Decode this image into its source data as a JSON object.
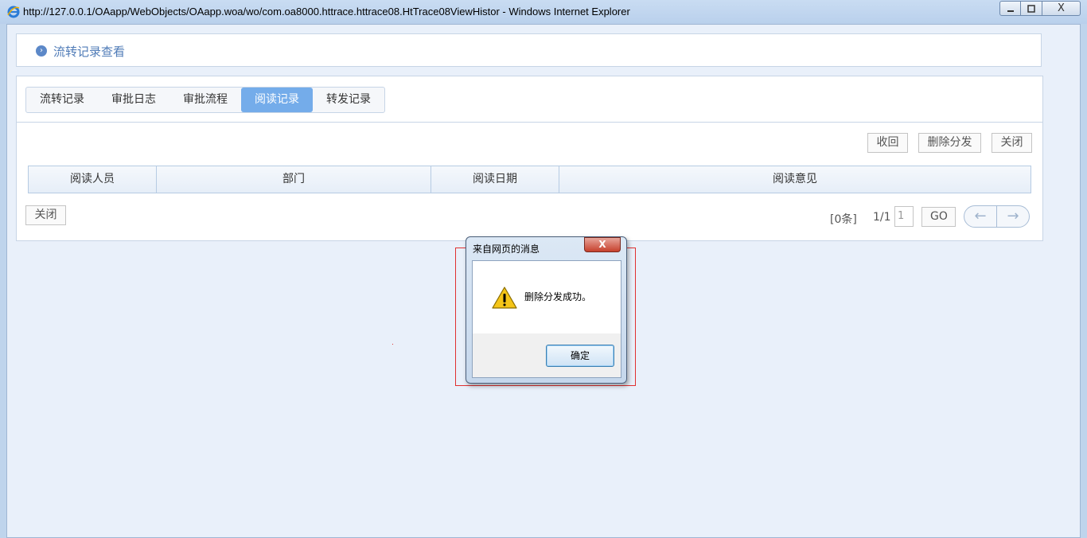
{
  "window": {
    "title": "http://127.0.0.1/OAapp/WebObjects/OAapp.woa/wo/com.oa8000.httrace.httrace08.HtTrace08ViewHistor - Windows Internet Explorer",
    "minimize_icon": "minimize-icon",
    "maximize_icon": "maximize-icon",
    "close_label": "X"
  },
  "header": {
    "title": "流转记录查看"
  },
  "tabs": [
    {
      "label": "流转记录",
      "active": false
    },
    {
      "label": "审批日志",
      "active": false
    },
    {
      "label": "审批流程",
      "active": false
    },
    {
      "label": "阅读记录",
      "active": true
    },
    {
      "label": "转发记录",
      "active": false
    }
  ],
  "toolbar": {
    "recall_label": "收回",
    "delete_distribution_label": "删除分发",
    "close_label": "关闭"
  },
  "table": {
    "columns": [
      "阅读人员",
      "部门",
      "阅读日期",
      "阅读意见"
    ],
    "rows": []
  },
  "footer": {
    "close_label": "关闭",
    "record_count": "[0条]",
    "page_indicator": "1/1",
    "page_input_value": "1",
    "go_label": "GO"
  },
  "dialog": {
    "title": "来自网页的消息",
    "close_label": "X",
    "message": "删除分发成功。",
    "ok_label": "确定",
    "icon": "warning-icon"
  }
}
